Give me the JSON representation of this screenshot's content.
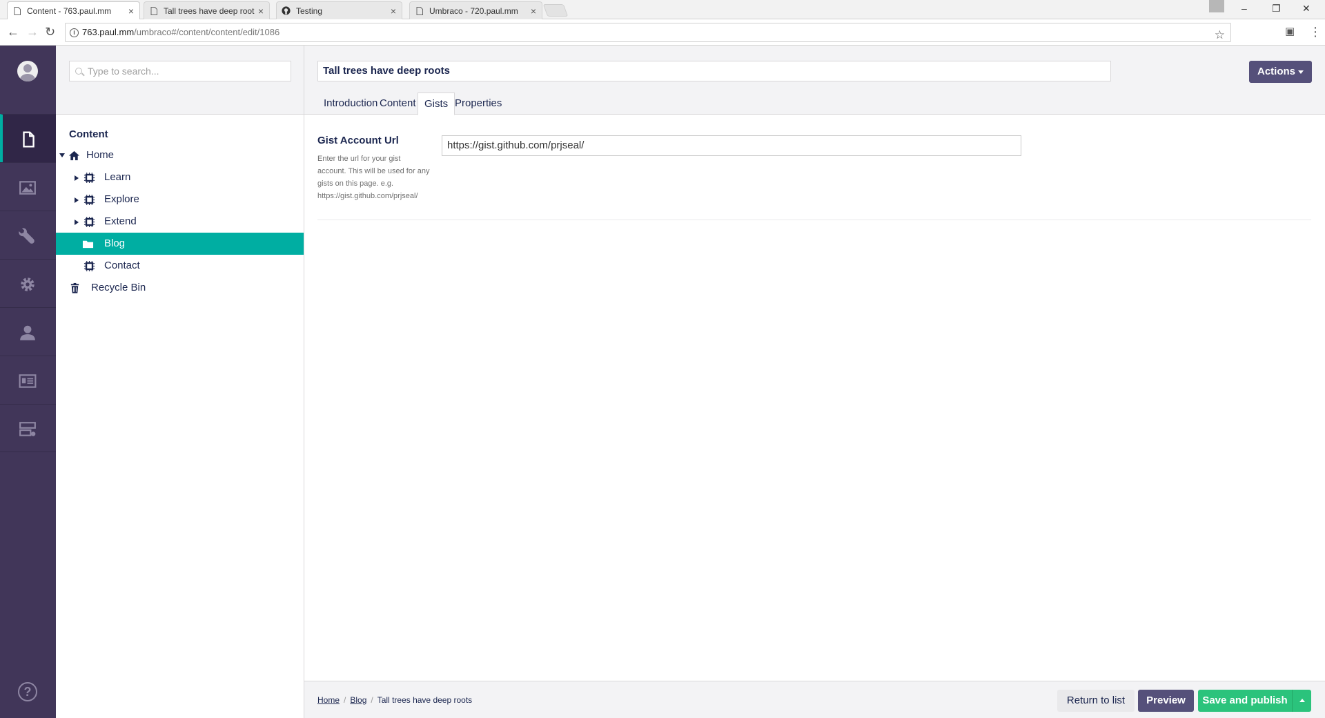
{
  "browser": {
    "tabs": [
      {
        "title": "Content - 763.paul.mm",
        "close": "×"
      },
      {
        "title": "Tall trees have deep root",
        "close": "×"
      },
      {
        "title": "Testing",
        "close": "×"
      },
      {
        "title": "Umbraco - 720.paul.mm",
        "close": "×"
      }
    ],
    "window_controls": {
      "minimize": "–",
      "restore": "❐",
      "close": "✕"
    },
    "nav": {
      "back": "←",
      "forward": "→",
      "reload": "↻"
    },
    "url_host": "763.paul.mm",
    "url_path": "/umbraco#/content/content/edit/1086",
    "star": "☆",
    "camera": "▣",
    "menu": "⋮"
  },
  "sections": [
    {
      "icon": "document-icon",
      "active": true
    },
    {
      "icon": "image-icon",
      "active": false
    },
    {
      "icon": "wrench-icon",
      "active": false
    },
    {
      "icon": "gear-icon",
      "active": false
    },
    {
      "icon": "user-icon",
      "active": false
    },
    {
      "icon": "id-card-icon",
      "active": false
    },
    {
      "icon": "server-icon",
      "active": false
    }
  ],
  "help_label": "?",
  "tree": {
    "search_placeholder": "Type to search...",
    "heading": "Content",
    "nodes": [
      {
        "label": "Home",
        "icon": "home-icon",
        "depth": 0,
        "caret": "down",
        "selected": false
      },
      {
        "label": "Learn",
        "icon": "chip-icon",
        "depth": 1,
        "caret": "right",
        "selected": false
      },
      {
        "label": "Explore",
        "icon": "chip-icon",
        "depth": 1,
        "caret": "right",
        "selected": false
      },
      {
        "label": "Extend",
        "icon": "chip-icon",
        "depth": 1,
        "caret": "right",
        "selected": false
      },
      {
        "label": "Blog",
        "icon": "folder-icon",
        "depth": 1,
        "caret": "none",
        "selected": true
      },
      {
        "label": "Contact",
        "icon": "chip-icon",
        "depth": 1,
        "caret": "none",
        "selected": false
      },
      {
        "label": "Recycle Bin",
        "icon": "trash-icon",
        "depth": 0,
        "caret": "none",
        "selected": false
      }
    ]
  },
  "editor": {
    "name": "Tall trees have deep roots",
    "actions_label": "Actions",
    "tabs": [
      "Introduction",
      "Content",
      "Gists",
      "Properties"
    ],
    "active_tab": "Gists",
    "property": {
      "label": "Gist Account Url",
      "description": "Enter the url for your gist account. This will be used for any gists on this page. e.g. https://gist.github.com/prjseal/",
      "value": "https://gist.github.com/prjseal/"
    }
  },
  "footer": {
    "breadcrumb": [
      "Home",
      "Blog",
      "Tall trees have deep roots"
    ],
    "separator": "/",
    "return_label": "Return to list",
    "preview_label": "Preview",
    "save_label": "Save and publish"
  },
  "colors": {
    "sidebar": "#413659",
    "accent": "#00aea2",
    "primary_button": "#55507a",
    "success": "#2bc37c"
  }
}
